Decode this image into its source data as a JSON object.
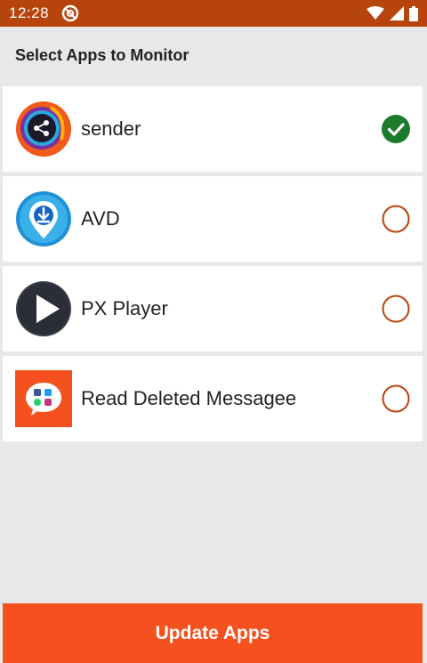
{
  "status_bar": {
    "time": "12:28"
  },
  "header": {
    "title": "Select Apps to Monitor"
  },
  "apps": [
    {
      "name": "sender",
      "selected": true,
      "icon": "sender-app-icon"
    },
    {
      "name": "AVD",
      "selected": false,
      "icon": "avd-app-icon"
    },
    {
      "name": "PX Player",
      "selected": false,
      "icon": "px-player-app-icon"
    },
    {
      "name": "Read Deleted Messagee",
      "selected": false,
      "icon": "read-deleted-messages-app-icon"
    }
  ],
  "footer": {
    "update_label": "Update Apps"
  },
  "colors": {
    "status_bar": "#b8440d",
    "accent": "#f4511e",
    "selected_check": "#1b7a2b",
    "unselected_ring": "#b8440d"
  }
}
